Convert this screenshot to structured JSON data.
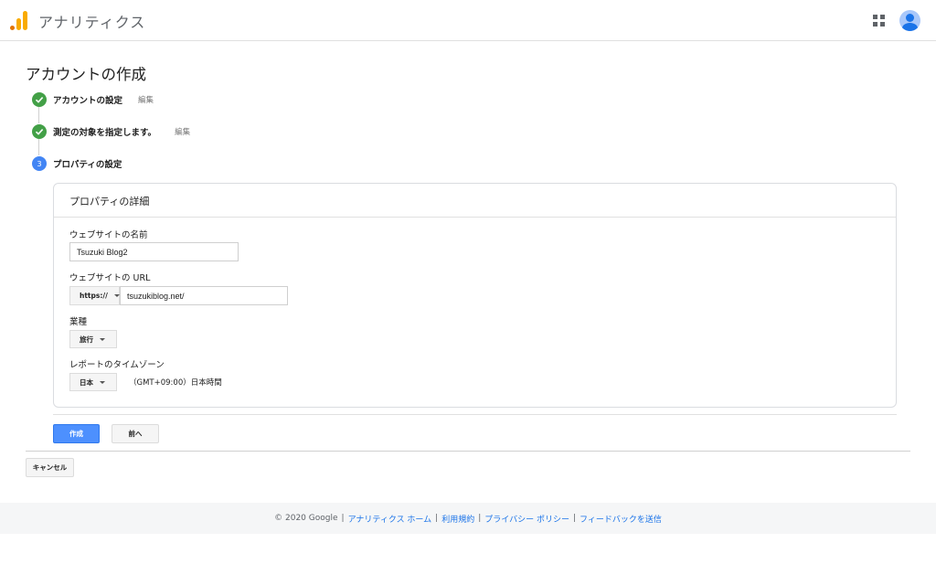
{
  "header": {
    "app_title": "アナリティクス",
    "logo_icon": "analytics-logo-icon",
    "apps_icon": "apps-grid-icon",
    "avatar_icon": "account-avatar-icon"
  },
  "page": {
    "title": "アカウントの作成"
  },
  "steps": [
    {
      "label": "アカウントの設定",
      "edit": "編集",
      "status": "done"
    },
    {
      "label": "測定の対象を指定します。",
      "edit": "編集",
      "status": "done"
    },
    {
      "number": "3",
      "label": "プロパティの設定",
      "status": "current"
    }
  ],
  "property_card": {
    "title": "プロパティの詳細",
    "site_name_label": "ウェブサイトの名前",
    "site_name_value": "Tsuzuki Blog2",
    "url_label": "ウェブサイトの URL",
    "protocol_value": "https://",
    "url_value": "tsuzukiblog.net/",
    "industry_label": "業種",
    "industry_value": "旅行",
    "timezone_label": "レポートのタイムゾーン",
    "country_value": "日本",
    "timezone_value": "（GMT+09:00）日本時間"
  },
  "actions": {
    "create": "作成",
    "previous": "前へ",
    "cancel": "キャンセル"
  },
  "footer": {
    "copyright": "© 2020 Google",
    "links": [
      "アナリティクス ホーム",
      "利用規約",
      "プライバシー ポリシー",
      "フィードバックを送信"
    ],
    "separator": "|"
  },
  "colors": {
    "step_done": "#43a047",
    "step_current": "#4285f4",
    "primary_button": "#4d90fe",
    "link": "#1a73e8",
    "logo_orange": "#f9ab00"
  }
}
